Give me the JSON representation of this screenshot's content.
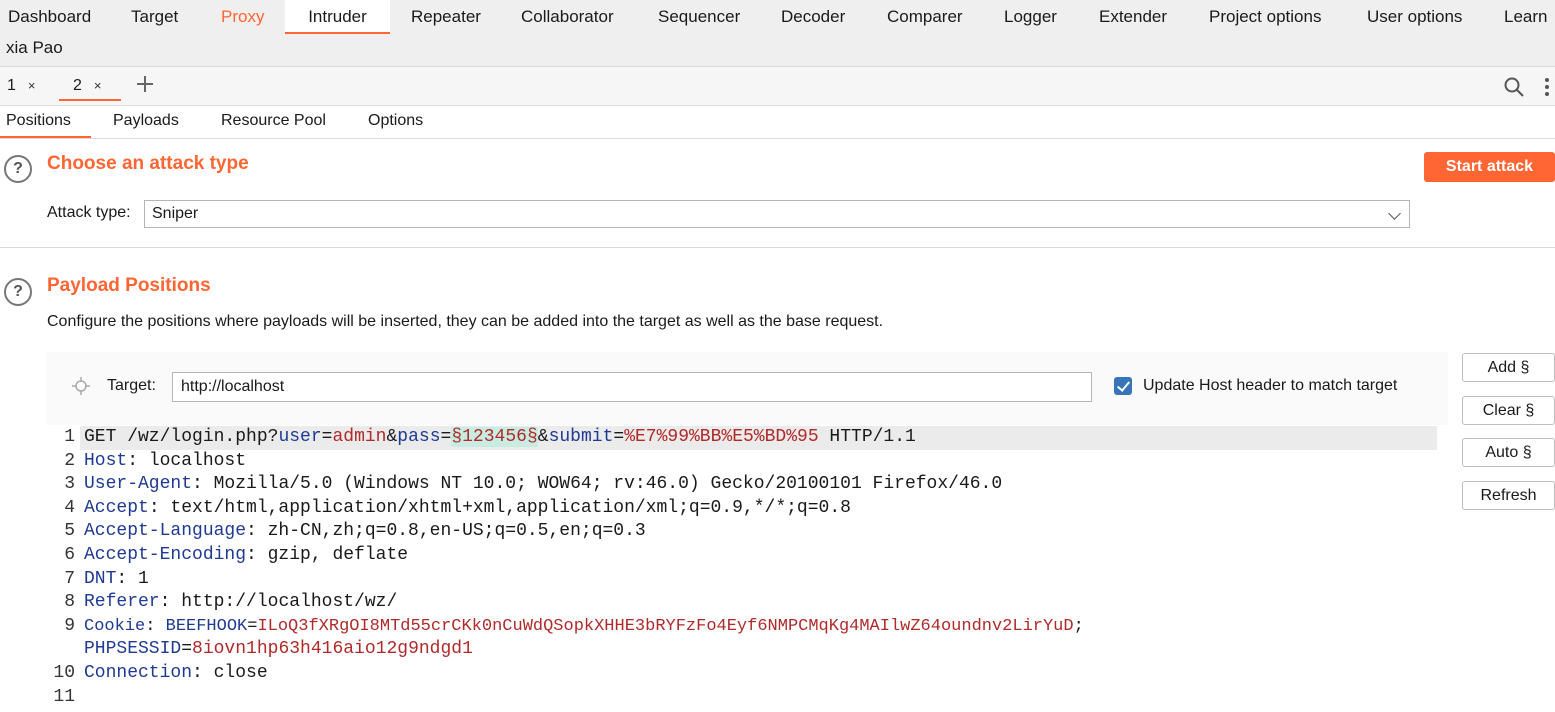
{
  "nav": {
    "tabs": [
      "Dashboard",
      "Target",
      "Proxy",
      "Intruder",
      "Repeater",
      "Collaborator",
      "Sequencer",
      "Decoder",
      "Comparer",
      "Logger",
      "Extender",
      "Project options",
      "User options",
      "Learn"
    ],
    "second_row": "xia Pao"
  },
  "attack_tabs": {
    "tab1": "1",
    "tab2": "2",
    "close": "×"
  },
  "intruder_tabs": [
    "Positions",
    "Payloads",
    "Resource Pool",
    "Options"
  ],
  "attack_type": {
    "title": "Choose an attack type",
    "label": "Attack type:",
    "value": "Sniper",
    "start_button": "Start attack"
  },
  "positions": {
    "title": "Payload Positions",
    "description": "Configure the positions where payloads will be inserted, they can be added into the target as well as the base request.",
    "target_label": "Target:",
    "target_value": "http://localhost",
    "update_host_label": "Update Host header to match target",
    "buttons": {
      "add": "Add §",
      "clear": "Clear §",
      "auto": "Auto §",
      "refresh": "Refresh"
    }
  },
  "request": {
    "line_numbers": [
      "1",
      "2",
      "3",
      "4",
      "5",
      "6",
      "7",
      "8",
      "9",
      "",
      "10",
      "11"
    ],
    "l1": {
      "method": "GET /wz/login.php?",
      "k1": "user",
      "eq1": "=",
      "v1": "admin",
      "amp1": "&",
      "k2": "pass",
      "eq2": "=",
      "v2": "§123456§",
      "amp2": "&",
      "k3": "submit",
      "eq3": "=",
      "v3": "%E7%99%BB%E5%BD%95",
      "proto": " HTTP/1.1"
    },
    "l2": {
      "k": "Host",
      "v": ": localhost"
    },
    "l3": {
      "k": "User-Agent",
      "v": ": Mozilla/5.0 (Windows NT 10.0; WOW64; rv:46.0) Gecko/20100101 Firefox/46.0"
    },
    "l4": {
      "k": "Accept",
      "v": ": text/html,application/xhtml+xml,application/xml;q=0.9,*/*;q=0.8"
    },
    "l5": {
      "k": "Accept-Language",
      "v": ": zh-CN,zh;q=0.8,en-US;q=0.5,en;q=0.3"
    },
    "l6": {
      "k": "Accept-Encoding",
      "v": ": gzip, deflate"
    },
    "l7": {
      "k": "DNT",
      "v": ": 1"
    },
    "l8": {
      "k": "Referer",
      "v": ": http://localhost/wz/"
    },
    "l9": {
      "k": "Cookie",
      "sep": ": ",
      "k2": "BEEFHOOK",
      "eq": "=",
      "v2": "ILoQ3fXRgOI8MTd55crCKk0nCuWdQSopkXHHE3bRYFzFo4Eyf6NMPCMqKg4MAIlwZ64oundnv2LirYuD",
      "semi": ";"
    },
    "l9b": {
      "k": "PHPSESSID",
      "eq": "=",
      "v": "8iovn1hp63h416aio12g9ndgd1"
    },
    "l10": {
      "k": "Connection",
      "v": ": close"
    }
  }
}
